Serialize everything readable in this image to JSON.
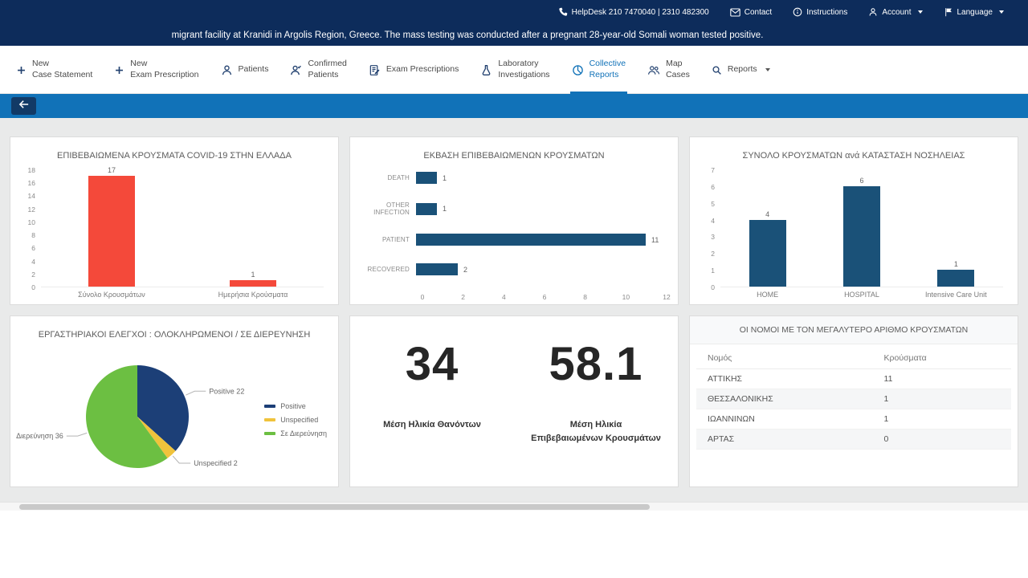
{
  "colors": {
    "header_navy": "#0d2c5b",
    "bar_blue": "#1172b8",
    "chart_red": "#f4493a",
    "chart_navy": "#1a5178",
    "pie_navy": "#1c3f77",
    "pie_yellow": "#f0c33c",
    "pie_green": "#6cbf42"
  },
  "topbar": {
    "helpdesk": "HelpDesk   210 7470040  |  2310 482300",
    "contact": "Contact",
    "instructions": "Instructions",
    "account": "Account",
    "language": "Language",
    "icons": [
      "phone-icon",
      "envelope-icon",
      "info-icon",
      "account-icon",
      "flag-icon"
    ]
  },
  "ticker": {
    "text": "migrant facility at Kranidi in Argolis Region, Greece. The mass testing was conducted after a pregnant 28-year-old Somali woman tested positive."
  },
  "nav": {
    "items": [
      {
        "line1": "New",
        "line2": "Case Statement",
        "icon": "plus-icon"
      },
      {
        "line1": "New",
        "line2": "Exam Prescription",
        "icon": "plus-icon"
      },
      {
        "line1": "Patients",
        "line2": "",
        "icon": "person-icon"
      },
      {
        "line1": "Confirmed",
        "line2": "Patients",
        "icon": "person-check-icon"
      },
      {
        "line1": "Exam Prescriptions",
        "line2": "",
        "icon": "document-pencil-icon"
      },
      {
        "line1": "Laboratory",
        "line2": "Investigations",
        "icon": "flask-icon"
      },
      {
        "line1": "Collective",
        "line2": "Reports",
        "icon": "pie-chart-icon"
      },
      {
        "line1": "Map",
        "line2": "Cases",
        "icon": "people-icon"
      },
      {
        "line1": "Reports",
        "line2": "",
        "icon": "search-icon"
      }
    ],
    "active_index": 6
  },
  "chart_data": [
    {
      "id": "confirmed-cases",
      "type": "bar",
      "title": "ΕΠΙΒΕΒΑΙΩΜΕΝΑ ΚΡΟΥΣΜΑΤΑ COVID-19 ΣΤΗΝ ΕΛΛΑΔΑ",
      "categories": [
        "Σύνολο Κρουσμάτων",
        "Ημερήσια Κρούσματα"
      ],
      "values": [
        17,
        1
      ],
      "ylim": [
        0,
        18
      ],
      "ytick_step": 2,
      "bar_color": "#f4493a",
      "grid": false,
      "legend": "none"
    },
    {
      "id": "outcome",
      "type": "horizontal-bar",
      "title": "ΕΚΒΑΣΗ ΕΠΙΒΕΒΑΙΩΜΕΝΩΝ ΚΡΟΥΣΜΑΤΩΝ",
      "categories": [
        "DEATH",
        "OTHER INFECTION",
        "PATIENT",
        "RECOVERED"
      ],
      "values": [
        1,
        1,
        11,
        2
      ],
      "xlim": [
        0,
        12
      ],
      "xtick_step": 2,
      "bar_color": "#1a5178",
      "grid": false,
      "legend": "none"
    },
    {
      "id": "hospitalization",
      "type": "bar",
      "title": "ΣΥΝΟΛΟ ΚΡΟΥΣΜΑΤΩΝ ανά ΚΑΤΑΣΤΑΣΗ ΝΟΣΗΛΕΙΑΣ",
      "categories": [
        "HOME",
        "HOSPITAL",
        "Intensive Care Unit"
      ],
      "values": [
        4,
        6,
        1
      ],
      "ylim": [
        0,
        7
      ],
      "ytick_step": 1,
      "bar_color": "#1a5178",
      "grid": false,
      "legend": "none"
    },
    {
      "id": "lab-tests",
      "type": "pie",
      "title": "ΕΡΓΑΣΤΗΡΙΑΚΟΙ ΕΛΕΓΧΟΙ : ΟΛΟΚΛΗΡΩΜΕΝΟΙ / ΣΕ ΔΙΕΡΕΥΝΗΣΗ",
      "slices": [
        {
          "label": "Positive",
          "value": 22,
          "color": "#1c3f77"
        },
        {
          "label": "Unspecified",
          "value": 2,
          "color": "#f0c33c"
        },
        {
          "label": "Σε Διερεύνηση",
          "value": 36,
          "color": "#6cbf42"
        }
      ],
      "legend_position": "right"
    }
  ],
  "stats": {
    "items": [
      {
        "value": "34",
        "label": "Μέση Ηλικία Θανόντων"
      },
      {
        "value": "58.1",
        "label": "Μέση Ηλικία\nΕπιβεβαιωμένων Κρουσμάτων"
      }
    ]
  },
  "table": {
    "title": "ΟΙ ΝΟΜΟΙ ΜΕ ΤΟΝ ΜΕΓΑΛΥΤΕΡΟ ΑΡΙΘΜΟ ΚΡΟΥΣΜΑΤΩΝ",
    "columns": [
      "Νομός",
      "Κρούσματα"
    ],
    "rows": [
      [
        "ΑΤΤΙΚΗΣ",
        "11"
      ],
      [
        "ΘΕΣΣΑΛΟΝΙΚΗΣ",
        "1"
      ],
      [
        "ΙΩΑΝΝΙΝΩΝ",
        "1"
      ],
      [
        "ΑΡΤΑΣ",
        "0"
      ]
    ]
  }
}
